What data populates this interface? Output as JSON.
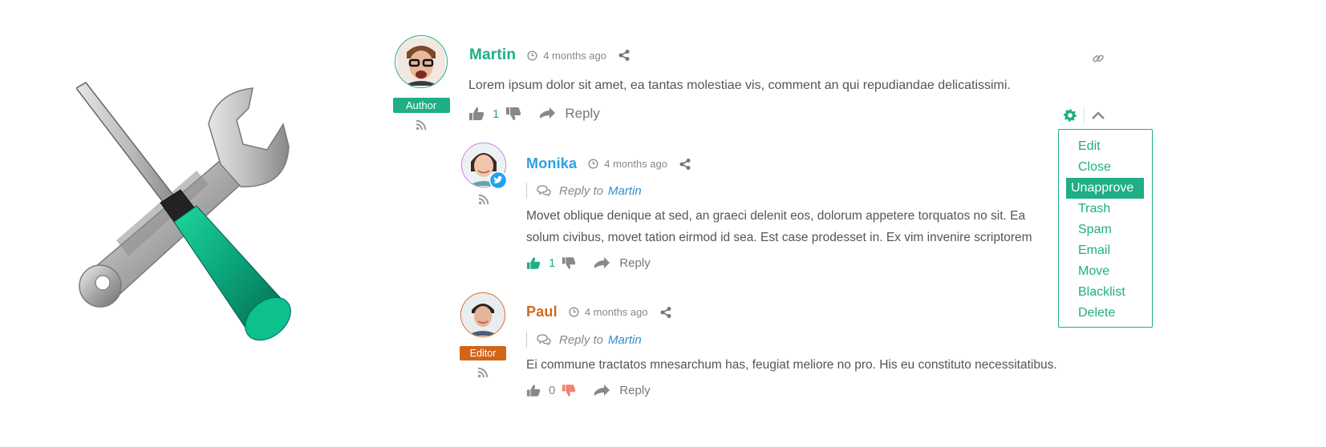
{
  "comments": [
    {
      "name": "Martin",
      "name_color": "#1fae86",
      "avatar_border": "#1fae86",
      "role": "Author",
      "role_color": "#1fae86",
      "time": "4 months ago",
      "text_lines": [
        "Lorem ipsum dolor sit amet, ea tantas molestiae vis, comment an qui repudiandae delicatissimi."
      ],
      "votes": "1",
      "reply_label": "Reply"
    },
    {
      "name": "Monika",
      "name_color": "#2f9fe0",
      "avatar_border": "#c77be0",
      "time": "4 months ago",
      "reply_to_label": "Reply to",
      "reply_to_name": "Martin",
      "text_lines": [
        "Movet oblique denique at sed, an graeci delenit eos, dolorum appetere torquatos no sit. Ea",
        "solum civibus, movet tation eirmod id sea. Est case prodesset in. Ex vim invenire scriptorem"
      ],
      "votes": "1",
      "reply_label": "Reply"
    },
    {
      "name": "Paul",
      "name_color": "#d2691e",
      "avatar_border": "#d2691e",
      "role": "Editor",
      "role_color": "#d2651a",
      "time": "4 months ago",
      "reply_to_label": "Reply to",
      "reply_to_name": "Martin",
      "text_lines": [
        "Ei commune tractatos mnesarchum has, feugiat meliore no pro. His eu constituto necessitatibus."
      ],
      "votes": "0",
      "reply_label": "Reply"
    }
  ],
  "menu": {
    "items": [
      "Edit",
      "Close",
      "Unapprove",
      "Trash",
      "Spam",
      "Email",
      "Move",
      "Blacklist",
      "Delete"
    ],
    "active_index": 2
  },
  "icons": {
    "hero": "tools-icon",
    "like": "thumbs-up-icon",
    "dislike": "thumbs-down-icon",
    "reply": "reply-arrow-icon",
    "share": "share-icon",
    "clock": "clock-icon",
    "rss": "rss-icon",
    "link": "link-icon",
    "settings": "gear-icon",
    "collapse": "chevron-up-icon",
    "twitter": "twitter-icon",
    "reply_to": "comments-icon"
  },
  "colors": {
    "accent": "#1fae86",
    "dislike_active": "#f0826e"
  }
}
